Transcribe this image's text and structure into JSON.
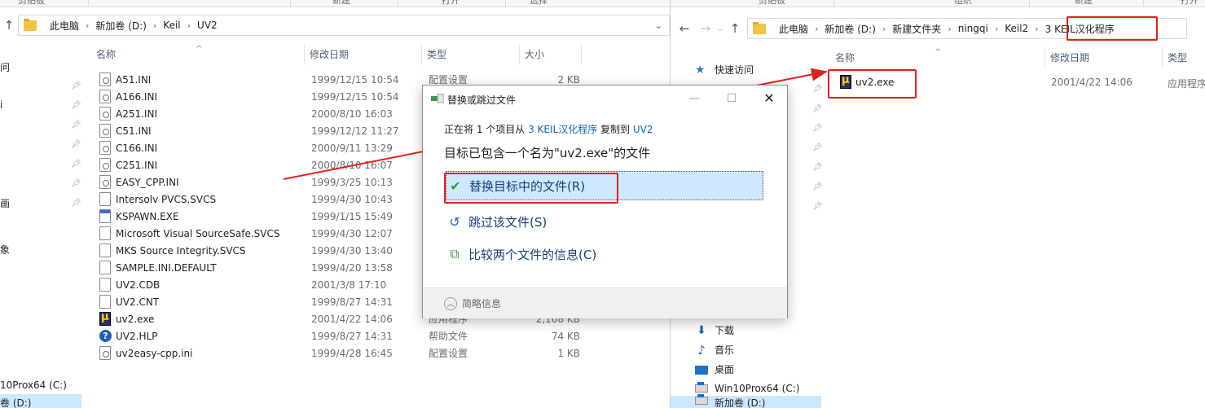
{
  "left_window": {
    "ribbon": [
      "剪贴板",
      "新建",
      "打开",
      "选择"
    ],
    "breadcrumb": [
      "此电脑",
      "新加卷 (D:)",
      "Keil",
      "UV2"
    ],
    "columns": [
      "名称",
      "修改日期",
      "类型",
      "大小"
    ],
    "nav_fragments": [
      "问",
      "i",
      "画",
      "象",
      "10Prox64 (C:)",
      "卷 (D:)"
    ],
    "files": [
      {
        "name": "A51.INI",
        "date": "1999/12/15 10:54",
        "type": "配置设置",
        "size": "2 KB",
        "icon": "ini-icon"
      },
      {
        "name": "A166.INI",
        "date": "1999/12/15 10:54",
        "type": "",
        "size": "",
        "icon": "ini-icon"
      },
      {
        "name": "A251.INI",
        "date": "2000/8/10 16:03",
        "type": "",
        "size": "",
        "icon": "ini-icon"
      },
      {
        "name": "C51.INI",
        "date": "1999/12/12 11:27",
        "type": "",
        "size": "",
        "icon": "ini-icon"
      },
      {
        "name": "C166.INI",
        "date": "2000/9/11 13:29",
        "type": "",
        "size": "",
        "icon": "ini-icon"
      },
      {
        "name": "C251.INI",
        "date": "2000/8/10 16:07",
        "type": "",
        "size": "",
        "icon": "ini-icon"
      },
      {
        "name": "EASY_CPP.INI",
        "date": "1999/3/25 10:13",
        "type": "",
        "size": "",
        "icon": "ini-icon"
      },
      {
        "name": "Intersolv PVCS.SVCS",
        "date": "1999/4/30 10:43",
        "type": "",
        "size": "",
        "icon": "document-icon"
      },
      {
        "name": "KSPAWN.EXE",
        "date": "1999/1/15 15:49",
        "type": "",
        "size": "",
        "icon": "exe-icon"
      },
      {
        "name": "Microsoft Visual SourceSafe.SVCS",
        "date": "1999/4/30 12:07",
        "type": "",
        "size": "",
        "icon": "document-icon"
      },
      {
        "name": "MKS Source Integrity.SVCS",
        "date": "1999/4/30 13:40",
        "type": "",
        "size": "",
        "icon": "document-icon"
      },
      {
        "name": "SAMPLE.INI.DEFAULT",
        "date": "1999/4/20 13:58",
        "type": "",
        "size": "",
        "icon": "document-icon"
      },
      {
        "name": "UV2.CDB",
        "date": "2001/3/8 17:10",
        "type": "",
        "size": "",
        "icon": "document-icon"
      },
      {
        "name": "UV2.CNT",
        "date": "1999/8/27 14:31",
        "type": "",
        "size": "",
        "icon": "document-icon"
      },
      {
        "name": "uv2.exe",
        "date": "2001/4/22 14:06",
        "type": "应用程序",
        "size": "2,108 KB",
        "icon": "uvision-icon"
      },
      {
        "name": "UV2.HLP",
        "date": "1999/8/27 14:31",
        "type": "帮助文件",
        "size": "74 KB",
        "icon": "help-icon"
      },
      {
        "name": "uv2easy-cpp.ini",
        "date": "1999/4/28 16:45",
        "type": "配置设置",
        "size": "1 KB",
        "icon": "ini-icon"
      }
    ]
  },
  "right_window": {
    "ribbon": [
      "剪贴板",
      "组织",
      "新建",
      "打开"
    ],
    "breadcrumb": [
      "此电脑",
      "新加卷 (D:)",
      "新建文件夹",
      "ningqi",
      "Keil2",
      "3 KEIL汉化程序"
    ],
    "columns": [
      "名称",
      "修改日期",
      "类型"
    ],
    "nav": [
      {
        "label": "快速访问",
        "icon": "star-icon"
      },
      {
        "label": "下载",
        "icon": "download-icon"
      },
      {
        "label": "音乐",
        "icon": "music-icon"
      },
      {
        "label": "桌面",
        "icon": "desktop-icon"
      },
      {
        "label": "Win10Prox64 (C:)",
        "icon": "drive-icon"
      },
      {
        "label": "新加卷 (D:)",
        "icon": "drive-icon"
      }
    ],
    "files": [
      {
        "name": "uv2.exe",
        "date": "2001/4/22 14:06",
        "type": "应用程序"
      }
    ]
  },
  "dialog": {
    "title": "替换或跳过文件",
    "line1_prefix": "正在将 1 个项目从 ",
    "line1_source": "3 KEIL汉化程序",
    "line1_middle": " 复制到 ",
    "line1_dest": "UV2",
    "line2": "目标已包含一个名为\"uv2.exe\"的文件",
    "options": [
      {
        "label": "替换目标中的文件(R)",
        "icon": "checkmark-icon"
      },
      {
        "label": "跳过该文件(S)",
        "icon": "skip-icon"
      },
      {
        "label": "比较两个文件的信息(C)",
        "icon": "compare-icon"
      }
    ],
    "footer": "简略信息"
  },
  "colors": {
    "annotation_red": "#e0211b",
    "selection_blue": "#cde8ff",
    "link_blue": "#0d62c6"
  }
}
